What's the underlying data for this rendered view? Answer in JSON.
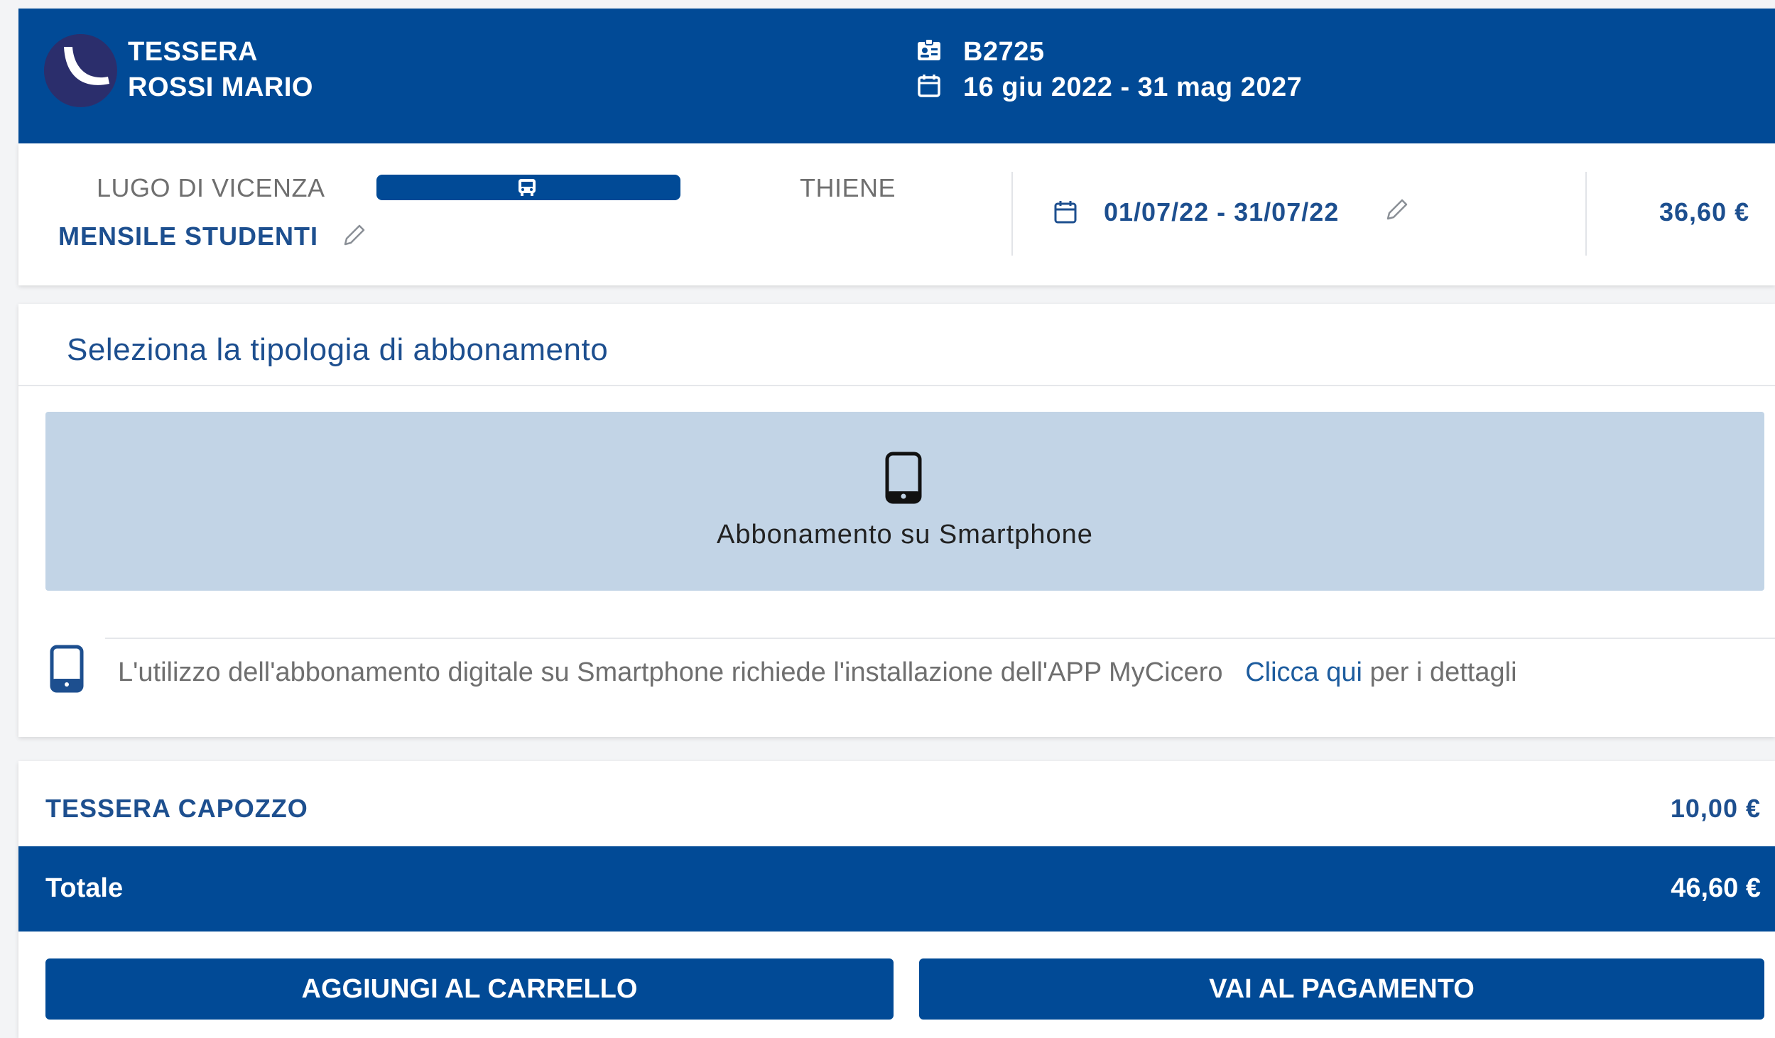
{
  "header": {
    "card_type": "TESSERA",
    "holder_name": "ROSSI MARIO",
    "card_code": "B2725",
    "validity": "16 giu 2022 - 31 mag 2027"
  },
  "route": {
    "origin": "LUGO DI VICENZA",
    "destination": "THIENE",
    "fare_type": "MENSILE STUDENTI",
    "period": "01/07/22 - 31/07/22",
    "price": "36,60 €"
  },
  "selection": {
    "title": "Seleziona la tipologia di abbonamento",
    "option_label": "Abbonamento su Smartphone",
    "info_text": "L'utilizzo dell'abbonamento digitale su Smartphone richiede l'installazione dell'APP MyCicero",
    "info_link": "Clicca qui",
    "info_suffix": "per i dettagli"
  },
  "summary": {
    "item_label": "TESSERA CAPOZZO",
    "item_price": "10,00 €",
    "total_label": "Totale",
    "total_price": "46,60 €"
  },
  "actions": {
    "add_to_cart": "AGGIUNGI AL CARRELLO",
    "go_to_payment": "VAI AL PAGAMENTO"
  },
  "colors": {
    "primary": "#014A96",
    "option_bg": "#c2d4e6",
    "accent_text": "#1d4f8f"
  }
}
